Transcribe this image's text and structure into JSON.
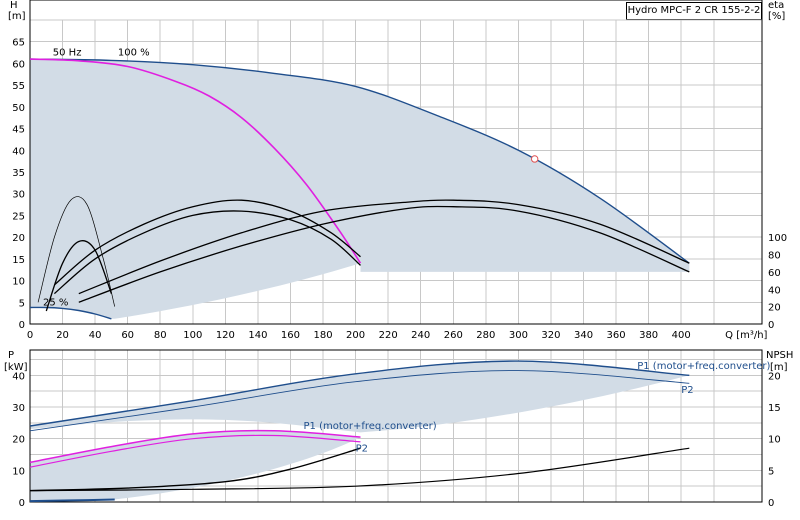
{
  "chart_data": [
    {
      "type": "line",
      "panel": "head",
      "title": "Hydro MPC-F 2 CR 155-2-2",
      "xlabel": "Q [m³/h]",
      "ylabel_left": "H\n[m]",
      "ylabel_right": "eta\n[%]",
      "xlim": [
        0,
        420
      ],
      "ylim_left": [
        0,
        70
      ],
      "ylim_right": [
        0,
        100
      ],
      "x_ticks": [
        0,
        20,
        40,
        60,
        80,
        100,
        120,
        140,
        160,
        180,
        200,
        220,
        240,
        260,
        280,
        300,
        320,
        340,
        360,
        380,
        400
      ],
      "y_ticks_left": [
        0,
        5,
        10,
        15,
        20,
        25,
        30,
        35,
        40,
        45,
        50,
        55,
        60,
        65
      ],
      "y_ticks_right": [
        0,
        20,
        40,
        60,
        80,
        100
      ],
      "annotations": [
        "50 Hz",
        "100 %",
        "25 %"
      ],
      "colors": {
        "head_curve": "#1f4e8c",
        "system_curve": "#e020e0",
        "envelope": "#d2dce6",
        "duty_point": "#e05050"
      },
      "series": [
        {
          "key": "head_2pumps",
          "x": [
            0,
            50,
            100,
            150,
            200,
            250,
            300,
            350,
            405
          ],
          "y": [
            61,
            60.7,
            59.7,
            57.7,
            54.7,
            48,
            40,
            29,
            14
          ]
        },
        {
          "key": "head_1pump",
          "x": [
            0,
            30,
            60,
            90,
            110,
            130,
            150,
            170,
            190,
            203
          ],
          "y": [
            61,
            60.6,
            59.3,
            55.8,
            52.5,
            47.5,
            40.5,
            32,
            21.5,
            14
          ]
        },
        {
          "key": "head_min_25",
          "x": [
            0,
            10,
            20,
            30,
            40,
            50
          ],
          "y": [
            3.8,
            3.8,
            3.6,
            3.1,
            2.3,
            1.2
          ]
        },
        {
          "key": "eta_2pumps_a",
          "x": [
            30,
            80,
            130,
            180,
            230,
            260,
            300,
            350,
            405
          ],
          "y": [
            5,
            12,
            18,
            23,
            26.5,
            27,
            26,
            21,
            12
          ]
        },
        {
          "key": "eta_2pumps_b",
          "x": [
            30,
            80,
            130,
            180,
            230,
            260,
            300,
            350,
            405
          ],
          "y": [
            7,
            14.5,
            21,
            26,
            28,
            28.5,
            27.5,
            23,
            14
          ]
        },
        {
          "key": "eta_1pump_a",
          "x": [
            15,
            40,
            70,
            100,
            130,
            160,
            185,
            203
          ],
          "y": [
            7,
            15,
            21,
            25,
            26,
            24,
            19.5,
            13.5
          ]
        },
        {
          "key": "eta_1pump_b",
          "x": [
            15,
            40,
            70,
            100,
            130,
            160,
            185,
            203
          ],
          "y": [
            9,
            17,
            23,
            27,
            28.5,
            26,
            21,
            15.5
          ]
        },
        {
          "key": "eta_small_a",
          "x": [
            10,
            20,
            30,
            40,
            50
          ],
          "y": [
            3,
            14,
            19,
            17,
            7
          ]
        },
        {
          "key": "eta_small_b",
          "x": [
            5,
            15,
            25,
            35,
            45,
            52
          ],
          "y": [
            5,
            20,
            28.5,
            27.5,
            15,
            4
          ]
        }
      ],
      "duty_point": {
        "x": 310,
        "y": 38
      }
    },
    {
      "type": "line",
      "panel": "power",
      "ylabel_left": "P\n[kW]",
      "ylabel_right": "NPSH\n[m]",
      "ylim_left": [
        0,
        48
      ],
      "ylim_right": [
        0,
        24
      ],
      "y_ticks_left": [
        0,
        10,
        20,
        30,
        40
      ],
      "y_ticks_right": [
        0,
        5,
        10,
        15,
        20
      ],
      "series": [
        {
          "name": "P1 (motor+freq.converter)",
          "x": [
            0,
            100,
            200,
            300,
            405
          ],
          "y": [
            24,
            32,
            40.5,
            44.5,
            40
          ]
        },
        {
          "name": "P2",
          "x": [
            0,
            100,
            200,
            300,
            405
          ],
          "y": [
            22.5,
            30,
            38,
            41.5,
            37.5
          ]
        },
        {
          "key": "p1_1pump",
          "x": [
            0,
            50,
            100,
            150,
            203
          ],
          "y": [
            12.5,
            17.5,
            21.5,
            22.5,
            20.5
          ]
        },
        {
          "key": "p2_1pump",
          "x": [
            0,
            50,
            100,
            150,
            203
          ],
          "y": [
            11,
            16,
            20,
            21,
            19
          ]
        },
        {
          "key": "p_25",
          "x": [
            0,
            25,
            52
          ],
          "y": [
            0.3,
            0.5,
            0.8
          ]
        },
        {
          "key": "npsh_2pumps",
          "x": [
            0,
            100,
            200,
            300,
            405
          ],
          "y": [
            1.8,
            2.0,
            2.5,
            4.5,
            8.5
          ]
        },
        {
          "key": "npsh_1pump",
          "x": [
            0,
            60,
            120,
            160,
            203
          ],
          "y": [
            1.8,
            2.2,
            3.2,
            5.2,
            8.5
          ]
        }
      ],
      "series_labels": [
        {
          "text": "P1 (motor+freq.converter)",
          "x": 373,
          "y": 42
        },
        {
          "text": "P2",
          "x": 400,
          "y": 34.5
        },
        {
          "text": "P1 (motor+freq.converter)",
          "x": 168,
          "y": 23
        },
        {
          "text": "P2",
          "x": 200,
          "y": 16
        }
      ]
    }
  ]
}
